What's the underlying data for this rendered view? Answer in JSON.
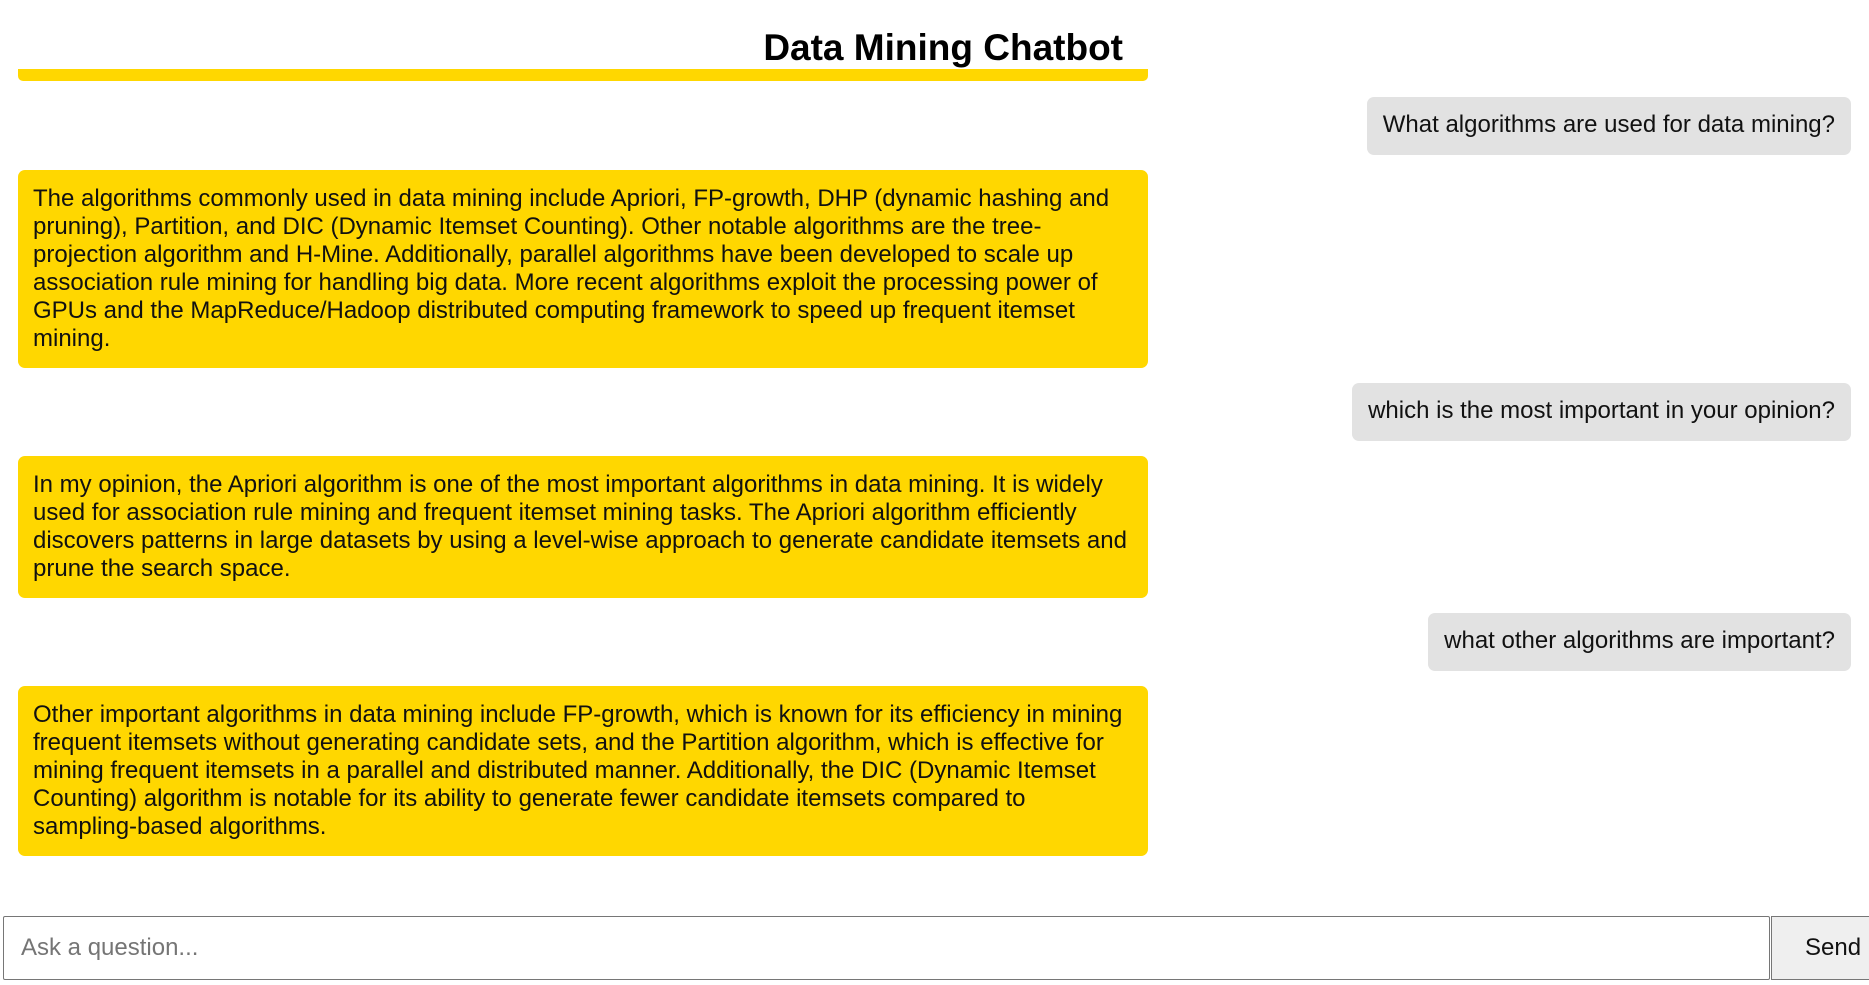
{
  "header": {
    "title": "Data Mining Chatbot"
  },
  "conversation": [
    {
      "role": "user",
      "text": "What algorithms are used for data mining?"
    },
    {
      "role": "bot",
      "text": "The algorithms commonly used in data mining include Apriori, FP-growth, DHP (dynamic hashing and pruning), Partition, and DIC (Dynamic Itemset Counting). Other notable algorithms are the tree-projection algorithm and H-Mine. Additionally, parallel algorithms have been developed to scale up association rule mining for handling big data. More recent algorithms exploit the processing power of GPUs and the MapReduce/Hadoop distributed computing framework to speed up frequent itemset mining."
    },
    {
      "role": "user",
      "text": "which is the most important in your opinion?"
    },
    {
      "role": "bot",
      "text": "In my opinion, the Apriori algorithm is one of the most important algorithms in data mining. It is widely used for association rule mining and frequent itemset mining tasks. The Apriori algorithm efficiently discovers patterns in large datasets by using a level-wise approach to generate candidate itemsets and prune the search space."
    },
    {
      "role": "user",
      "text": "what other algorithms are important?"
    },
    {
      "role": "bot",
      "text": "Other important algorithms in data mining include FP-growth, which is known for its efficiency in mining frequent itemsets without generating candidate sets, and the Partition algorithm, which is effective for mining frequent itemsets in a parallel and distributed manner. Additionally, the DIC (Dynamic Itemset Counting) algorithm is notable for its ability to generate fewer candidate itemsets compared to sampling-based algorithms."
    }
  ],
  "composer": {
    "placeholder": "Ask a question...",
    "value": "",
    "send_label": "Send"
  },
  "colors": {
    "accent": "#FFD700",
    "user_bubble": "#E2E2E2"
  }
}
